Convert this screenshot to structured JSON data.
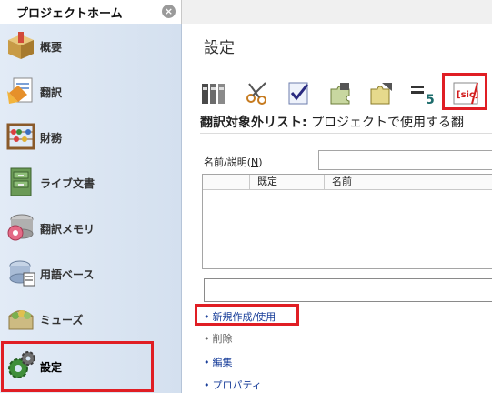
{
  "tab": {
    "home_label": "プロジェクトホーム",
    "close_glyph": "×"
  },
  "sidebar": {
    "items": [
      {
        "label": "概要",
        "icon": "overview-box-icon"
      },
      {
        "label": "翻訳",
        "icon": "translation-document-icon"
      },
      {
        "label": "財務",
        "icon": "finance-abacus-icon"
      },
      {
        "label": "ライブ文書",
        "icon": "live-documents-cabinet-icon"
      },
      {
        "label": "翻訳メモリ",
        "icon": "translation-memory-disk-icon"
      },
      {
        "label": "用語ベース",
        "icon": "termbase-icon"
      },
      {
        "label": "ミューズ",
        "icon": "muses-basket-icon"
      },
      {
        "label": "設定",
        "icon": "settings-gears-icon"
      }
    ],
    "active_item": "設定"
  },
  "main": {
    "title": "設定",
    "toolbar": [
      {
        "icon": "binders-icon"
      },
      {
        "icon": "scissors-icon"
      },
      {
        "icon": "checklist-icon"
      },
      {
        "icon": "puzzle-icon"
      },
      {
        "icon": "puzzle-arrow-icon"
      },
      {
        "icon": "segment-icon"
      },
      {
        "icon": "sic-non-translatables-icon",
        "label": "[sic]"
      }
    ],
    "section_heading_bold": "翻訳対象外リスト:",
    "section_heading_text": "プロジェクトで使用する翻",
    "filter_label_prefix": "名前/説明(",
    "filter_label_key": "N",
    "filter_label_suffix": ")",
    "filter_value": "",
    "grid_columns": [
      "既定",
      "名前"
    ],
    "grid_rows": [],
    "description_value": "",
    "actions": [
      {
        "bullet": "•",
        "label": "新規作成/使用",
        "enabled": true
      },
      {
        "bullet": "•",
        "label": "削除",
        "enabled": false
      },
      {
        "bullet": "•",
        "label": "編集",
        "enabled": true
      },
      {
        "bullet": "•",
        "label": "プロパティ",
        "enabled": true
      }
    ]
  },
  "colors": {
    "highlight_red": "#e01e24",
    "link_blue": "#1a3f9a",
    "sidebar_bg": "#dbe5f2"
  }
}
